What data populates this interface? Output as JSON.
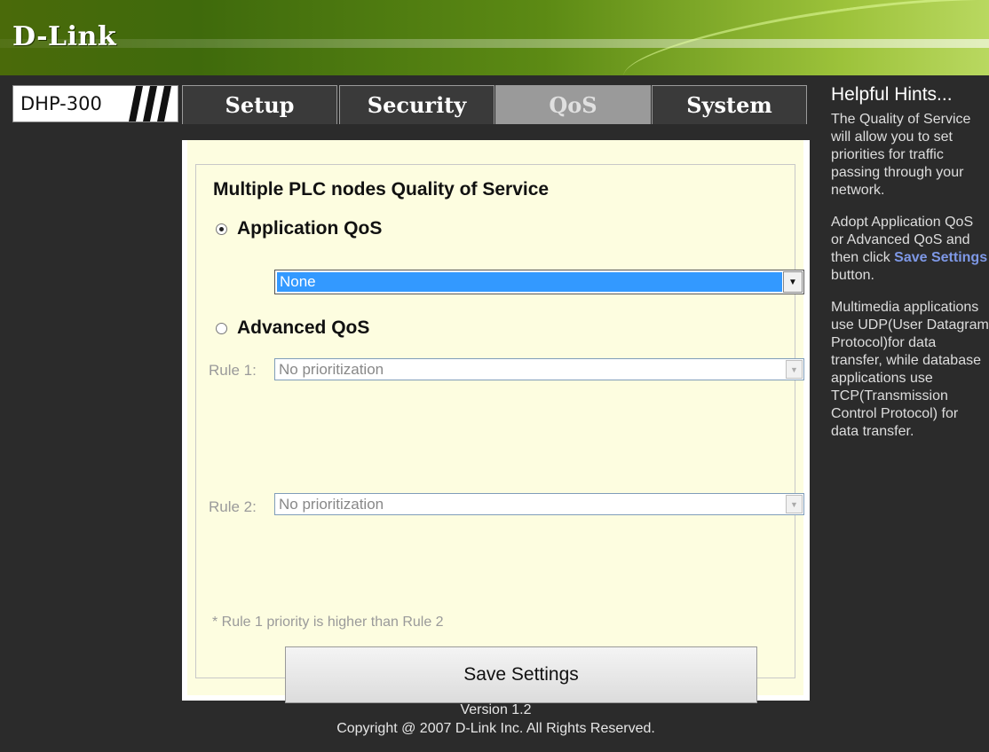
{
  "header": {
    "logo": "D-Link"
  },
  "model": "DHP-300",
  "tabs": [
    {
      "label": "Setup",
      "active": false
    },
    {
      "label": "Security",
      "active": false
    },
    {
      "label": "QoS",
      "active": true
    },
    {
      "label": "System",
      "active": false
    }
  ],
  "qos": {
    "section_title": "Multiple PLC nodes Quality of Service",
    "app_qos_label": "Application QoS",
    "app_qos_checked": true,
    "app_qos_value": "None",
    "adv_qos_label": "Advanced QoS",
    "adv_qos_checked": false,
    "rule1_label": "Rule 1:",
    "rule1_value": "No prioritization",
    "rule2_label": "Rule 2:",
    "rule2_value": "No prioritization",
    "note": "* Rule 1 priority is higher than Rule 2",
    "save_label": "Save Settings"
  },
  "footer": {
    "version": "Version 1.2",
    "copyright": "Copyright @ 2007 D-Link Inc. All Rights Reserved."
  },
  "hints": {
    "title": "Helpful Hints...",
    "para1": "The Quality of Service will allow you to set priorities for traffic passing through your network.",
    "para2_pre": "Adopt Application QoS or Advanced QoS and then click",
    "para2_link": "Save Settings",
    "para2_post": "button.",
    "para3": "Multimedia applications use UDP(User Datagram Protocol)for data transfer, while database applications use TCP(Transmission Control Protocol) for data transfer."
  },
  "colors": {
    "header_green": "#4a6a0a",
    "background": "#2b2b2b",
    "panel": "#fdfde0",
    "selection_blue": "#3399ff",
    "hint_link": "#7e98e6"
  }
}
